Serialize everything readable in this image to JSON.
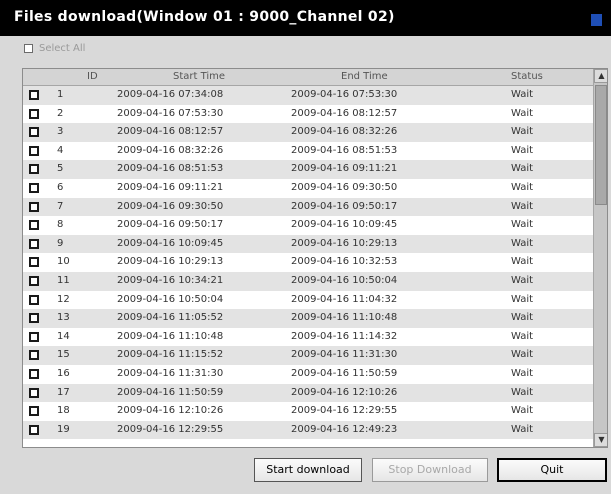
{
  "window": {
    "title": "Files download(Window 01 : 9000_Channel 02)"
  },
  "select_all": {
    "label": "Select All"
  },
  "table": {
    "headers": {
      "id": "ID",
      "start": "Start Time",
      "end": "End Time",
      "status": "Status"
    },
    "rows": [
      {
        "id": "1",
        "start": "2009-04-16  07:34:08",
        "end": "2009-04-16  07:53:30",
        "status": "Wait"
      },
      {
        "id": "2",
        "start": "2009-04-16  07:53:30",
        "end": "2009-04-16  08:12:57",
        "status": "Wait"
      },
      {
        "id": "3",
        "start": "2009-04-16  08:12:57",
        "end": "2009-04-16  08:32:26",
        "status": "Wait"
      },
      {
        "id": "4",
        "start": "2009-04-16  08:32:26",
        "end": "2009-04-16  08:51:53",
        "status": "Wait"
      },
      {
        "id": "5",
        "start": "2009-04-16  08:51:53",
        "end": "2009-04-16  09:11:21",
        "status": "Wait"
      },
      {
        "id": "6",
        "start": "2009-04-16  09:11:21",
        "end": "2009-04-16  09:30:50",
        "status": "Wait"
      },
      {
        "id": "7",
        "start": "2009-04-16  09:30:50",
        "end": "2009-04-16  09:50:17",
        "status": "Wait"
      },
      {
        "id": "8",
        "start": "2009-04-16  09:50:17",
        "end": "2009-04-16  10:09:45",
        "status": "Wait"
      },
      {
        "id": "9",
        "start": "2009-04-16  10:09:45",
        "end": "2009-04-16  10:29:13",
        "status": "Wait"
      },
      {
        "id": "10",
        "start": "2009-04-16  10:29:13",
        "end": "2009-04-16  10:32:53",
        "status": "Wait"
      },
      {
        "id": "11",
        "start": "2009-04-16  10:34:21",
        "end": "2009-04-16  10:50:04",
        "status": "Wait"
      },
      {
        "id": "12",
        "start": "2009-04-16  10:50:04",
        "end": "2009-04-16  11:04:32",
        "status": "Wait"
      },
      {
        "id": "13",
        "start": "2009-04-16  11:05:52",
        "end": "2009-04-16  11:10:48",
        "status": "Wait"
      },
      {
        "id": "14",
        "start": "2009-04-16  11:10:48",
        "end": "2009-04-16  11:14:32",
        "status": "Wait"
      },
      {
        "id": "15",
        "start": "2009-04-16  11:15:52",
        "end": "2009-04-16  11:31:30",
        "status": "Wait"
      },
      {
        "id": "16",
        "start": "2009-04-16  11:31:30",
        "end": "2009-04-16  11:50:59",
        "status": "Wait"
      },
      {
        "id": "17",
        "start": "2009-04-16  11:50:59",
        "end": "2009-04-16  12:10:26",
        "status": "Wait"
      },
      {
        "id": "18",
        "start": "2009-04-16  12:10:26",
        "end": "2009-04-16  12:29:55",
        "status": "Wait"
      },
      {
        "id": "19",
        "start": "2009-04-16  12:29:55",
        "end": "2009-04-16  12:49:23",
        "status": "Wait"
      }
    ]
  },
  "buttons": {
    "start": "Start download",
    "stop": "Stop Download",
    "quit": "Quit"
  },
  "colors": {
    "titlebar": "#000000",
    "title_accent": "#1f4fb6",
    "row_alt": "#e3e3e3",
    "disabled_text": "#a8a8a8"
  },
  "icons": {
    "scroll_up": "▲",
    "scroll_down": "▼"
  }
}
